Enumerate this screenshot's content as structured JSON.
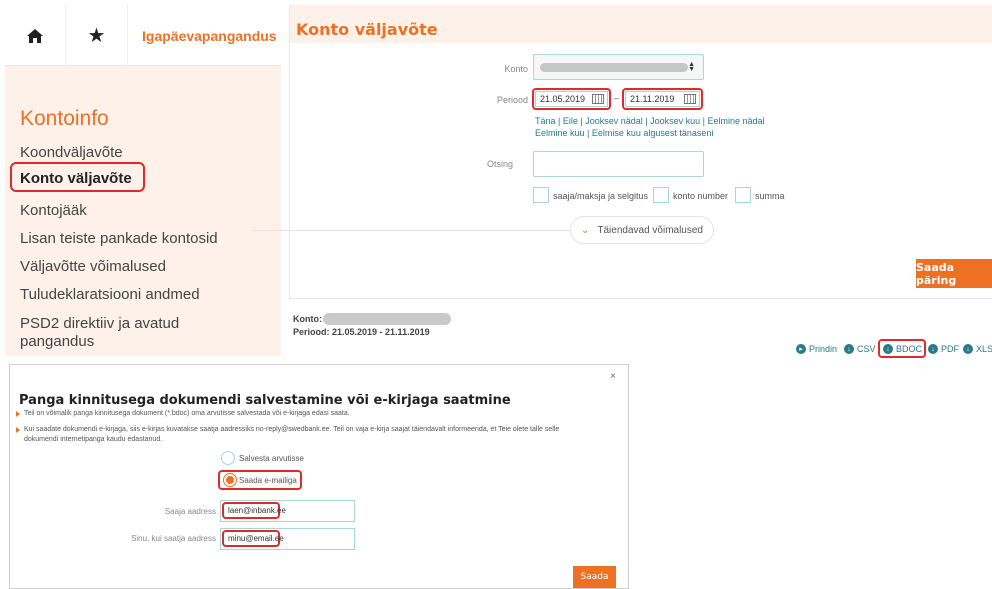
{
  "sidebar": {
    "home_icon": "home-icon",
    "star_icon": "star-icon",
    "daily_banking_label": "Igapäevapangandus",
    "section_title": "Kontoinfo",
    "items": [
      {
        "label": "Koondväljavõte"
      },
      {
        "label": "Konto väljavõte"
      },
      {
        "label": "Kontojääk"
      },
      {
        "label": "Lisan teiste pankade kontosid"
      },
      {
        "label": "Väljavõtte võimalused"
      },
      {
        "label": "Tuludeklaratsiooni andmed"
      },
      {
        "label": "PSD2 direktiiv ja avatud",
        "label2": "pangandus"
      }
    ],
    "active_item": "Konto väljavõte"
  },
  "main": {
    "title": "Konto väljavõte",
    "account_label": "Konto",
    "period_label": "Periood",
    "date_from": "21.05.2019",
    "date_to": "21.11.2019",
    "period_separator": "–",
    "quick_links_row1": [
      "Täna",
      "Eile",
      "Jooksev nädal",
      "Jooksev kuu",
      "Eelmine nädal"
    ],
    "quick_links_row2": [
      "Eelmine kuu",
      "Eelmise kuu algusest tänaseni"
    ],
    "search_label": "Otsing",
    "search_value": "",
    "filters": [
      "saaja/maksja ja selgitus",
      "konto number",
      "summa"
    ],
    "more_options_label": "Täiendavad võimalused",
    "submit_label": "Saada päring"
  },
  "result": {
    "account_label": "Konto:",
    "period_text": "Periood: 21.05.2019 - 21.11.2019",
    "downloads": [
      "Prindin",
      "CSV",
      "BDOC",
      "PDF",
      "XLS"
    ]
  },
  "dialog": {
    "close_label": "×",
    "title": "Panga kinnitusega dokumendi salvestamine või e-kirjaga saatmine",
    "bullet1": "Teil on võimalik panga kinnitusega dokument (*.bdoc) oma arvutisse salvestada või e-kirjaga edasi saata.",
    "bullet2_line1": "Kui saadate dokumendi e-kirjaga, siis e-kirjas kuvatakse saatja aadressiks no-reply@swedbank.ee. Teil on vaja e-kirja saajat täiendavalt informeerida, et Teie olete talle selle",
    "bullet2_line2": "dokumendi internetipanga kaudu edastanud.",
    "option_save": "Salvesta arvutisse",
    "option_email": "Saada e-mailiga",
    "selected_option": "Saada e-mailiga",
    "recipient_label": "Saaja aadress",
    "recipient_value": "laen@inbank.ee",
    "sender_label": "Sinu, kui saatja aadress",
    "sender_value": "minu@email.ee",
    "send_label": "Saada"
  },
  "colors": {
    "accent": "#ee7023",
    "highlight": "#e02a2a",
    "link": "#2a7a8c",
    "sidebar_bg": "#fdf1ea"
  }
}
